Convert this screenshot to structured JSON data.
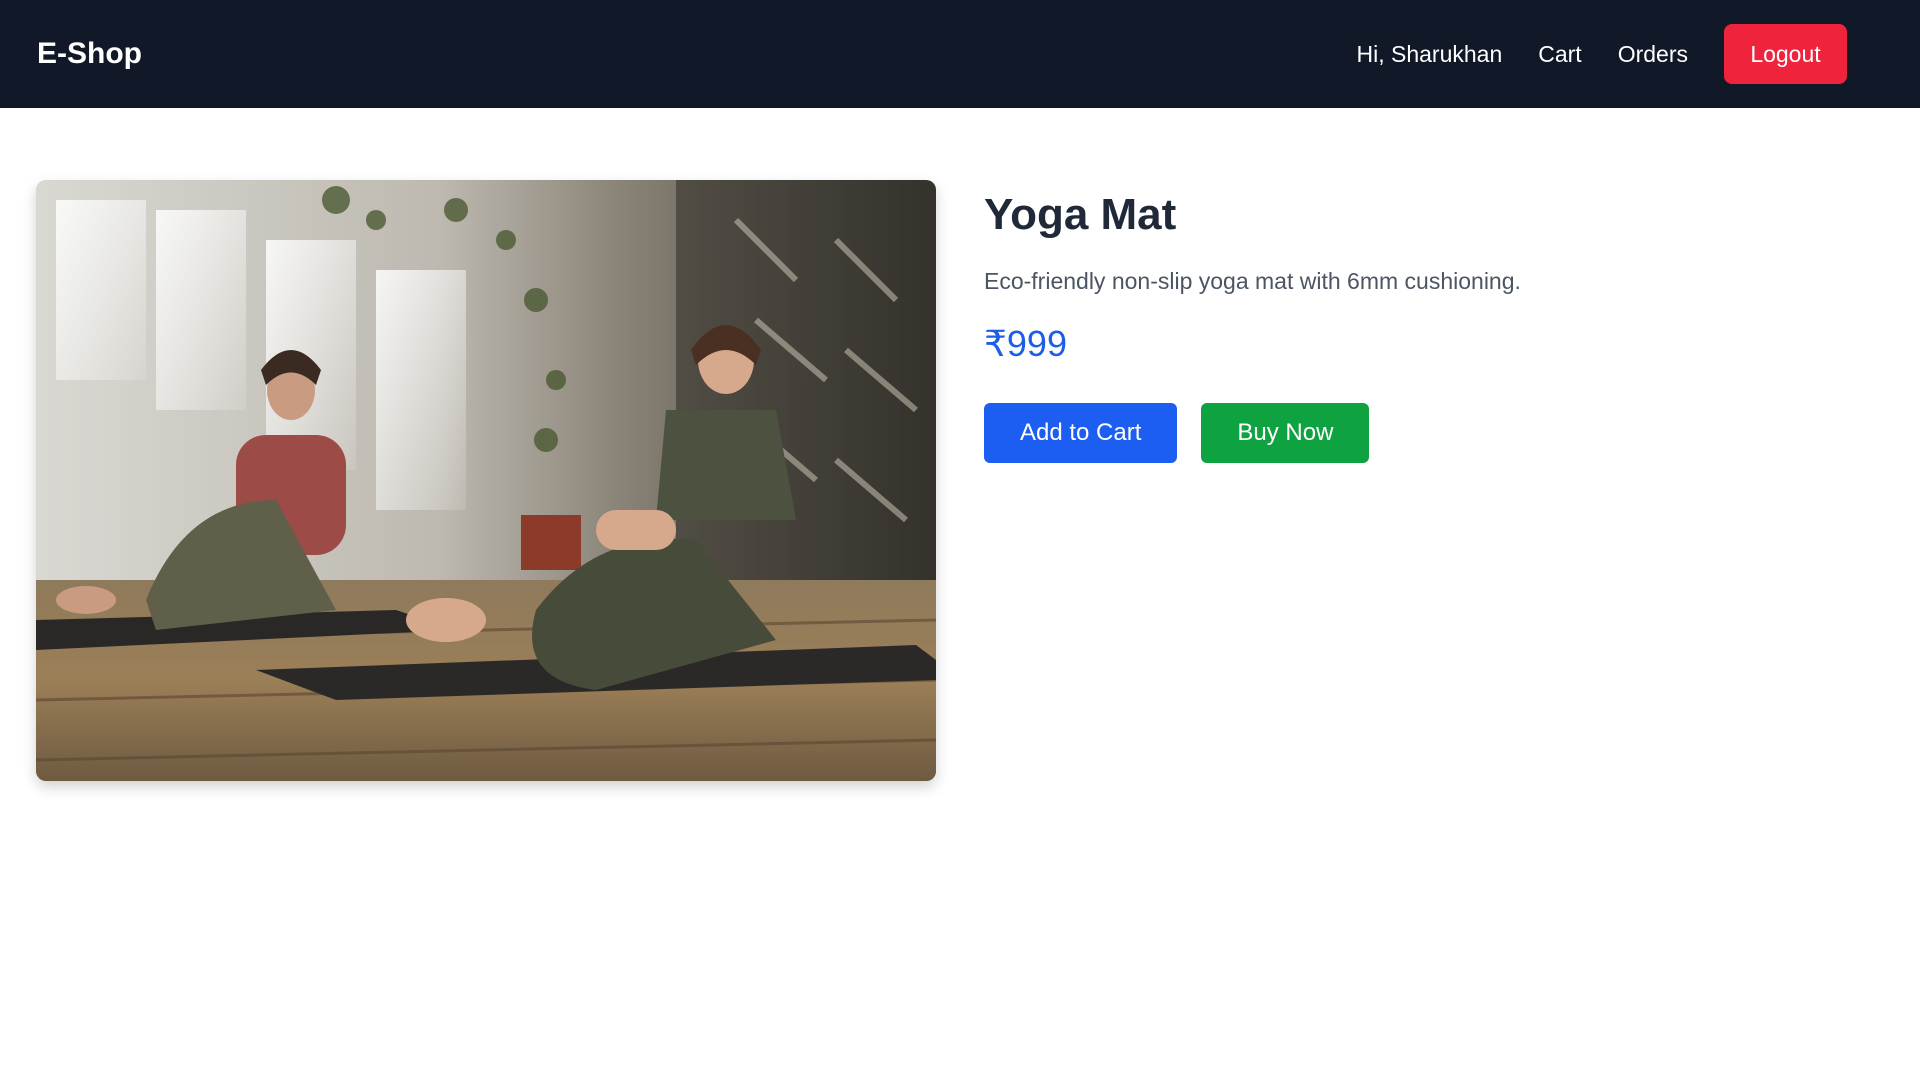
{
  "navbar": {
    "brand": "E-Shop",
    "greeting": "Hi, Sharukhan",
    "cart_label": "Cart",
    "orders_label": "Orders",
    "logout_label": "Logout"
  },
  "product": {
    "title": "Yoga Mat",
    "description": "Eco-friendly non-slip yoga mat with 6mm cushioning.",
    "price": "₹999",
    "add_to_cart_label": "Add to Cart",
    "buy_now_label": "Buy Now"
  },
  "colors": {
    "navbar_bg": "#111827",
    "logout": "#ef233c",
    "price": "#1d5ee6",
    "add_to_cart": "#1d5ef2",
    "buy_now": "#0ea340"
  }
}
